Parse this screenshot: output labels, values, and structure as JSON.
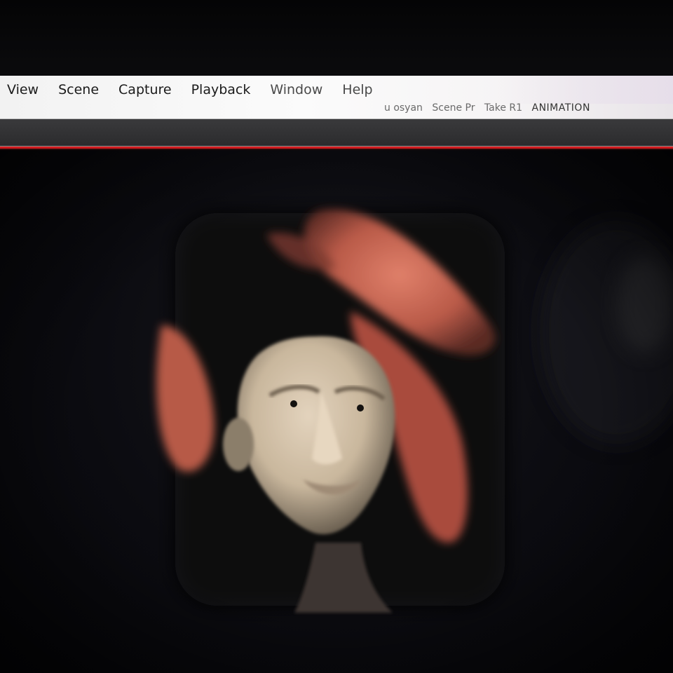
{
  "menu": {
    "items": [
      {
        "label": "View"
      },
      {
        "label": "Scene"
      },
      {
        "label": "Capture"
      },
      {
        "label": "Playback"
      },
      {
        "label": "Window"
      },
      {
        "label": "Help"
      }
    ]
  },
  "status": {
    "user": "u osyan",
    "scene": "Scene Pr",
    "take": "Take R1",
    "mode": "ANIMATION"
  },
  "colors": {
    "accent_line": "#d21a1f",
    "menubar_bg": "#f7f7f7",
    "viewport_bg": "#0b0b10"
  }
}
